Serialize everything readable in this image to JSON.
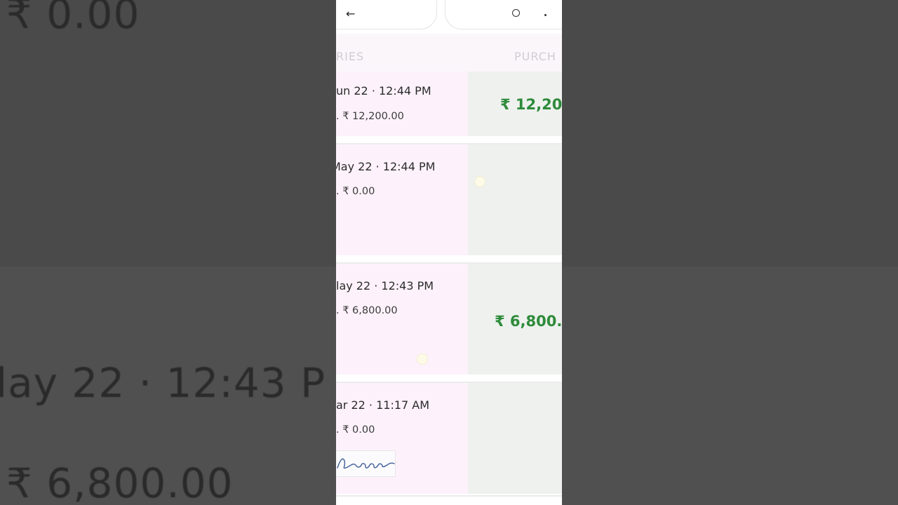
{
  "background": {
    "text_top": ". ₹ 0.00",
    "text_mid": "lay 22 · 12:43 P",
    "text_bottom": ". ₹ 6,800.00"
  },
  "header": {
    "back_icon": "←"
  },
  "columns": {
    "left": "RIES",
    "right": "PURCH"
  },
  "entries": [
    {
      "datetime": "un 22 · 12:44 PM",
      "balance": ". ₹ 12,200.00",
      "amount": "₹ 12,200."
    },
    {
      "datetime": "May 22 · 12:44 PM",
      "balance": ". ₹ 0.00",
      "amount": ""
    },
    {
      "datetime": "lay 22 · 12:43 PM",
      "balance": ". ₹ 6,800.00",
      "amount": "₹ 6,800."
    },
    {
      "datetime": "ar 22 · 11:17 AM",
      "balance": ". ₹ 0.00",
      "amount": ""
    }
  ],
  "colors": {
    "amount_green": "#2e8b3a",
    "entry_left_bg": "#fdf2fb",
    "entry_right_bg": "#eef1ee"
  },
  "icons": [
    "back-arrow-icon",
    "search-icon",
    "more-options-icon"
  ]
}
